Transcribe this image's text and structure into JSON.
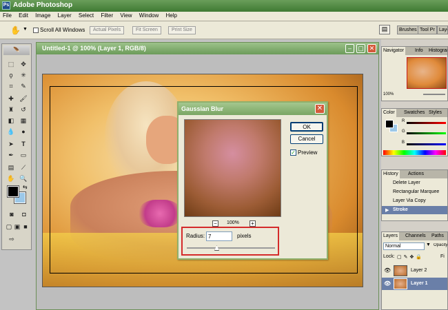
{
  "app": {
    "title": "Adobe Photoshop"
  },
  "menu": [
    "File",
    "Edit",
    "Image",
    "Layer",
    "Select",
    "Filter",
    "View",
    "Window",
    "Help"
  ],
  "options": {
    "scroll_all_windows": "Scroll All Windows",
    "actual_pixels": "Actual Pixels",
    "fit_screen": "Fit Screen",
    "print_size": "Print Size",
    "well_tabs": [
      "Brushes",
      "Tool Pr",
      "Laye"
    ]
  },
  "document": {
    "title": "Untitled-1 @ 100% (Layer 1, RGB/8)"
  },
  "dialog": {
    "title": "Gaussian Blur",
    "ok": "OK",
    "cancel": "Cancel",
    "preview_label": "Preview",
    "preview_checked": true,
    "zoom": "100%",
    "radius_label": "Radius:",
    "radius_value": "7",
    "radius_unit": "pixels"
  },
  "panels": {
    "navigator_tabs": [
      "Navigator",
      "Info",
      "Histogram"
    ],
    "navigator_zoom": "100%",
    "color_tabs": [
      "Color",
      "Swatches",
      "Styles"
    ],
    "color_channels": [
      "R",
      "G",
      "B"
    ],
    "history_tabs": [
      "History",
      "Actions"
    ],
    "history_items": [
      "Delete Layer",
      "Rectangular Marquee",
      "Layer Via Copy",
      "Stroke"
    ],
    "layers_tabs": [
      "Layers",
      "Channels",
      "Paths"
    ],
    "blend_mode": "Normal",
    "opacity_label": "Opacity",
    "lock_label": "Lock:",
    "fill_label": "Fi",
    "layers": [
      "Layer 2",
      "Layer 1"
    ]
  },
  "colors": {
    "accent": "#7aa664",
    "titlebar": "#3f7a33",
    "highlight_box": "#d42a2a"
  }
}
